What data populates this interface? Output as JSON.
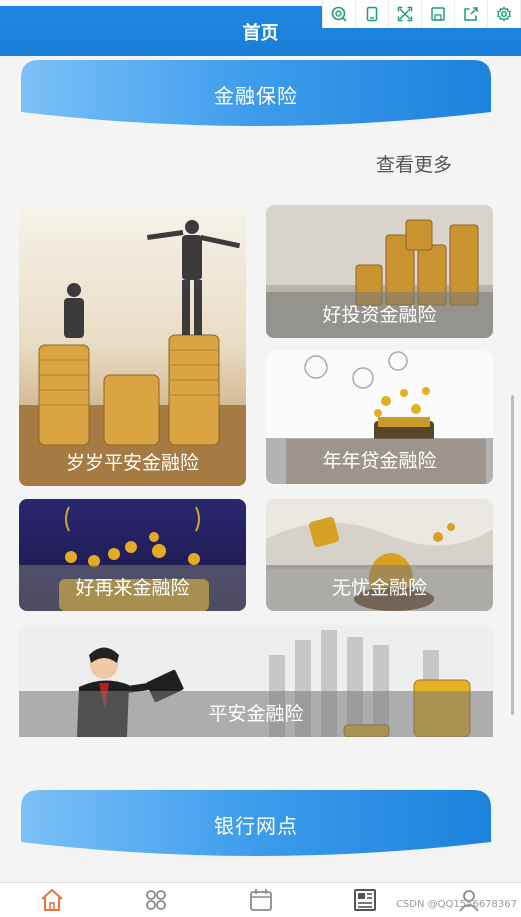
{
  "header": {
    "title": "首页"
  },
  "toolbar": {
    "icons": [
      "search-icon",
      "device-icon",
      "expand-icon",
      "save-icon",
      "share-icon",
      "settings-icon"
    ]
  },
  "sections": {
    "finance": {
      "title": "金融保险",
      "more": "查看更多"
    },
    "bank": {
      "title": "银行网点"
    }
  },
  "products": [
    {
      "name": "岁岁平安金融险"
    },
    {
      "name": "好投资金融险"
    },
    {
      "name": "年年贷金融险"
    },
    {
      "name": "好再来金融险"
    },
    {
      "name": "无忧金融险"
    },
    {
      "name": "平安金融险"
    }
  ],
  "bottom_nav": {
    "items": [
      "home-icon",
      "apps-icon",
      "calendar-icon",
      "news-icon",
      "user-icon"
    ],
    "active_color": "#e8743b",
    "inactive_color": "#8a8a8a"
  },
  "watermark": "CSDN @QQ1556678367",
  "colors": {
    "primary": "#1a7fd8",
    "banner_light": "#6fb8f6",
    "banner_dark": "#1c82dc"
  }
}
